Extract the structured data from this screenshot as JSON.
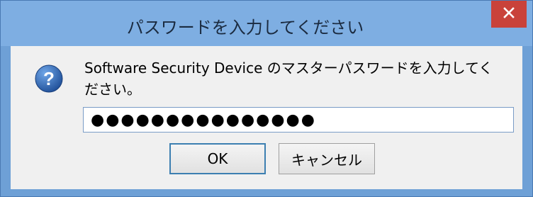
{
  "window": {
    "title": "パスワードを入力してください",
    "close_label": "×"
  },
  "dialog": {
    "message": "Software Security Device のマスターパスワードを入力してください。",
    "password_value": "●●●●●●●●●●●●●●●",
    "ok_label": "OK",
    "cancel_label": "キャンセル"
  },
  "icons": {
    "question": "question-icon",
    "close": "close-icon"
  },
  "colors": {
    "titlebar": "#7eaee2",
    "close_button": "#c9423a",
    "client_bg": "#f0f0f0",
    "question_icon": "#2a5fa8"
  }
}
